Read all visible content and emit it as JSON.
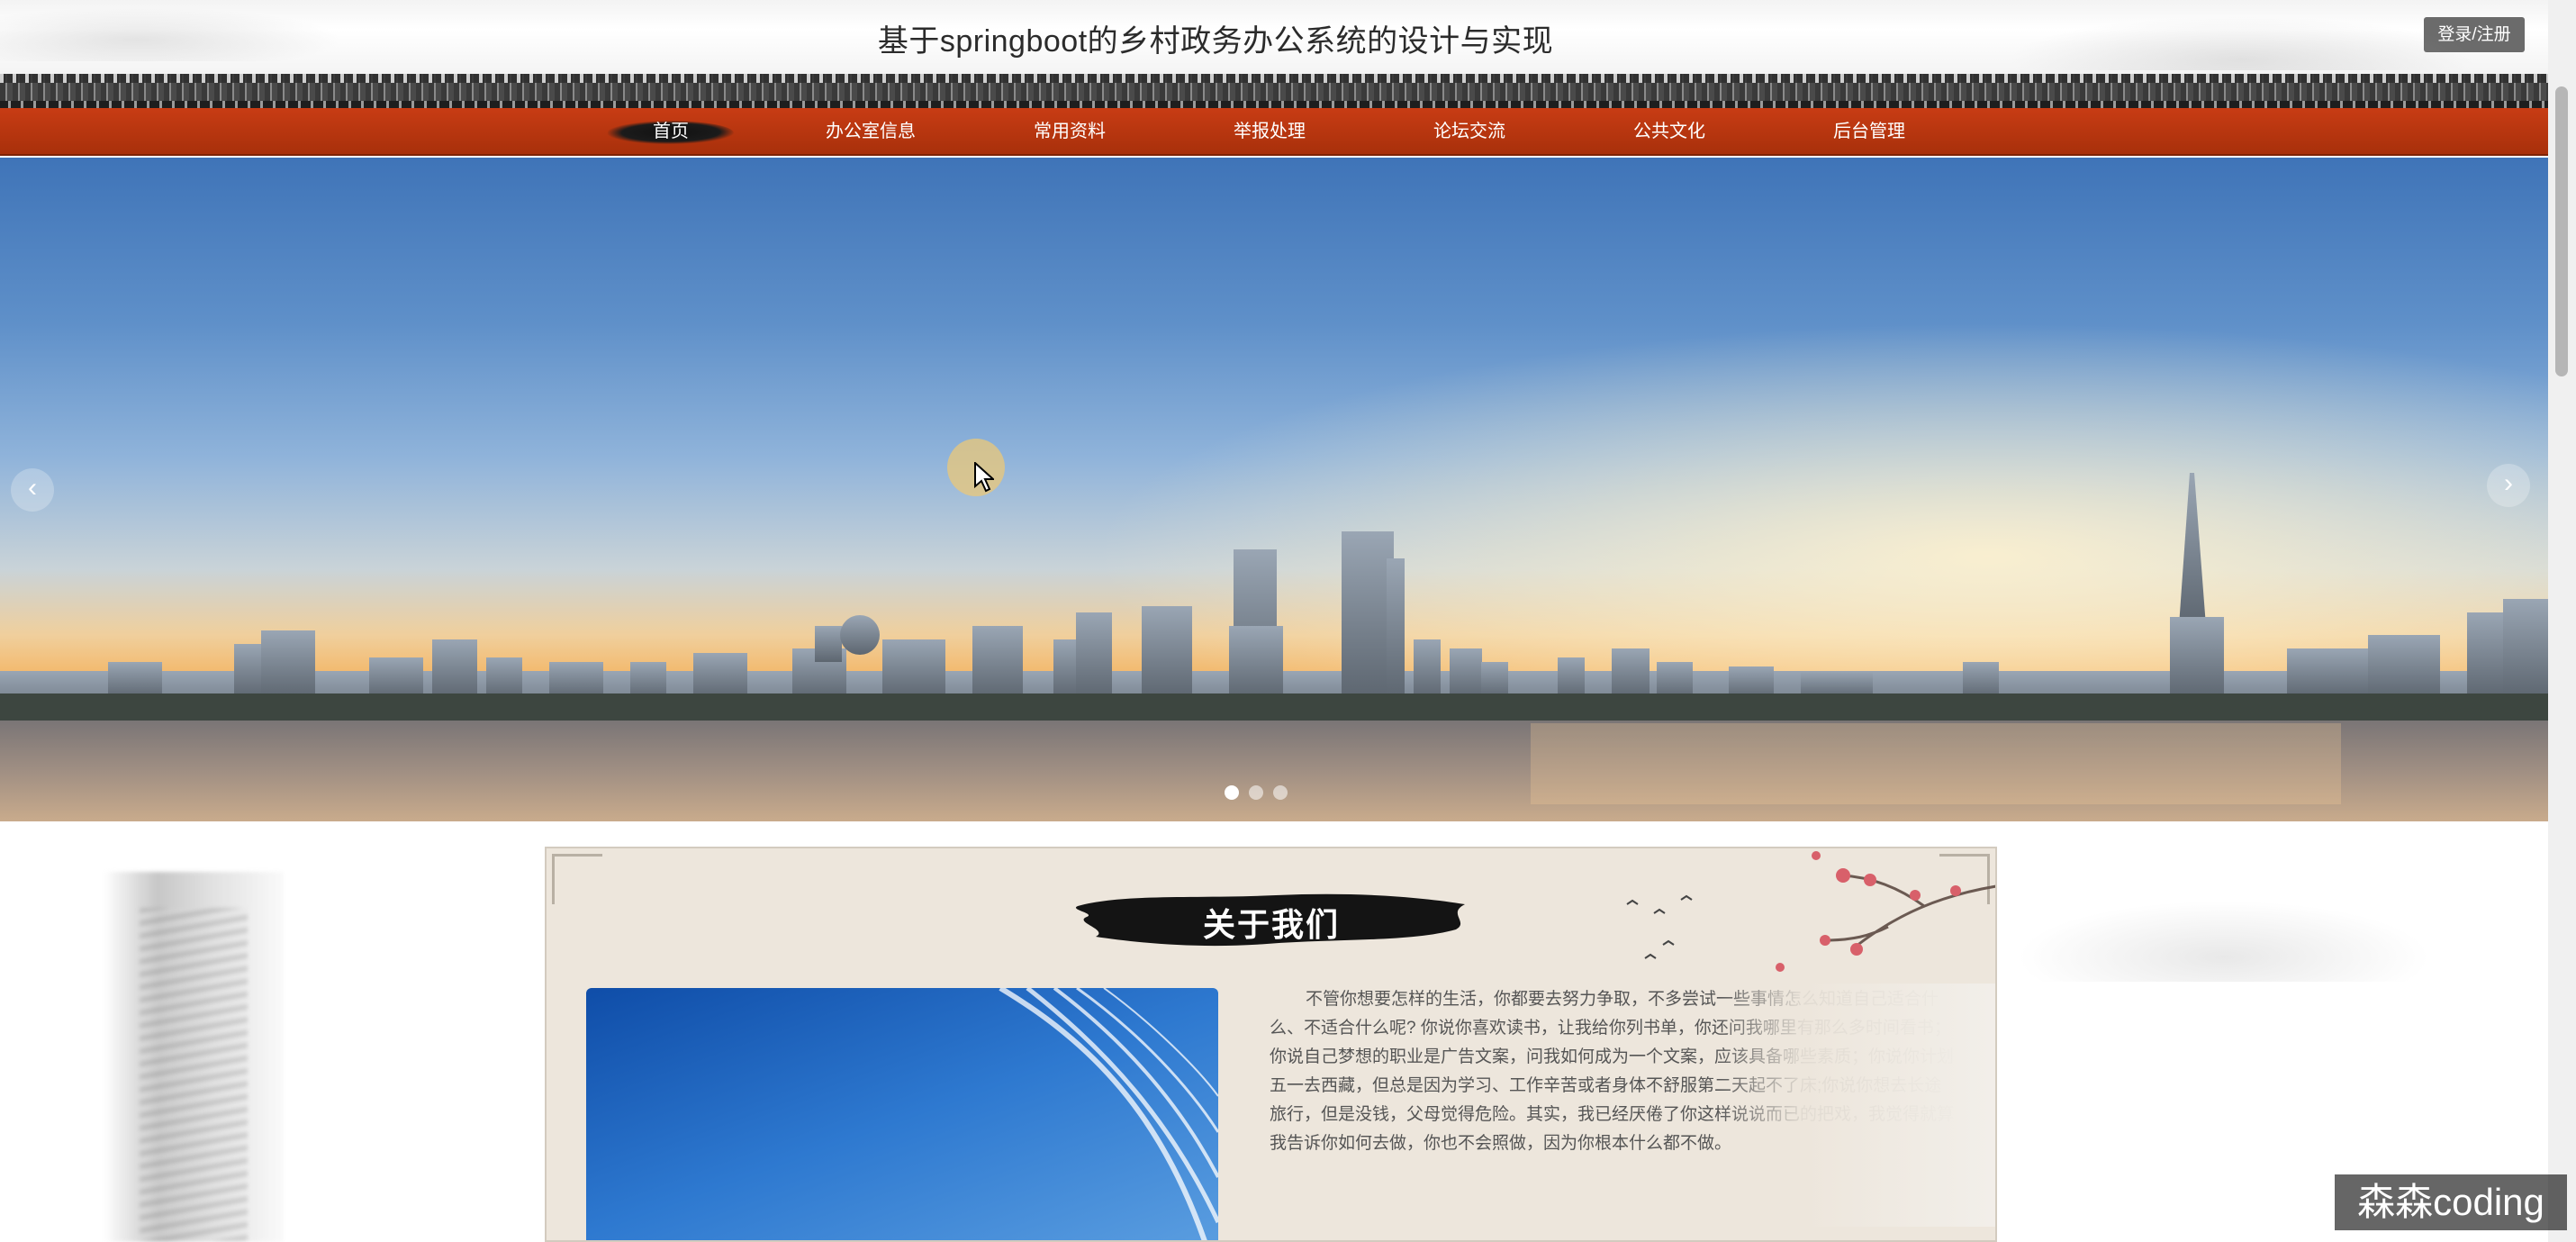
{
  "header": {
    "title": "基于springboot的乡村政务办公系统的设计与实现",
    "login_label": "登录/注册"
  },
  "nav": {
    "items": [
      {
        "label": "首页",
        "active": true
      },
      {
        "label": "办公室信息"
      },
      {
        "label": "常用资料"
      },
      {
        "label": "举报处理"
      },
      {
        "label": "论坛交流"
      },
      {
        "label": "公共文化"
      },
      {
        "label": "后台管理"
      }
    ]
  },
  "banner": {
    "prev_label": "‹",
    "next_label": "›",
    "slide_count": 3,
    "active_slide": 1
  },
  "about": {
    "title": "关于我们",
    "text": "不管你想要怎样的生活，你都要去努力争取，不多尝试一些事情怎么知道自己适合什么、不适合什么呢? 你说你喜欢读书，让我给你列书单，你还问我哪里有那么多时间看书；你说自己梦想的职业是广告文案，问我如何成为一个文案，应该具备哪些素质；你说你计划五一去西藏，但总是因为学习、工作辛苦或者身体不舒服第二天起不了床;你说你想去长途旅行，但是没钱，父母觉得危险。其实，我已经厌倦了你这样说说而已的把戏，我觉得就算我告诉你如何去做，你也不会照做，因为你根本什么都不做。"
  },
  "watermark": {
    "text": "森森coding"
  },
  "colors": {
    "nav_bg": "#b8350f",
    "login_bg": "#6b6b6b",
    "about_bg": "#ede6dc"
  }
}
